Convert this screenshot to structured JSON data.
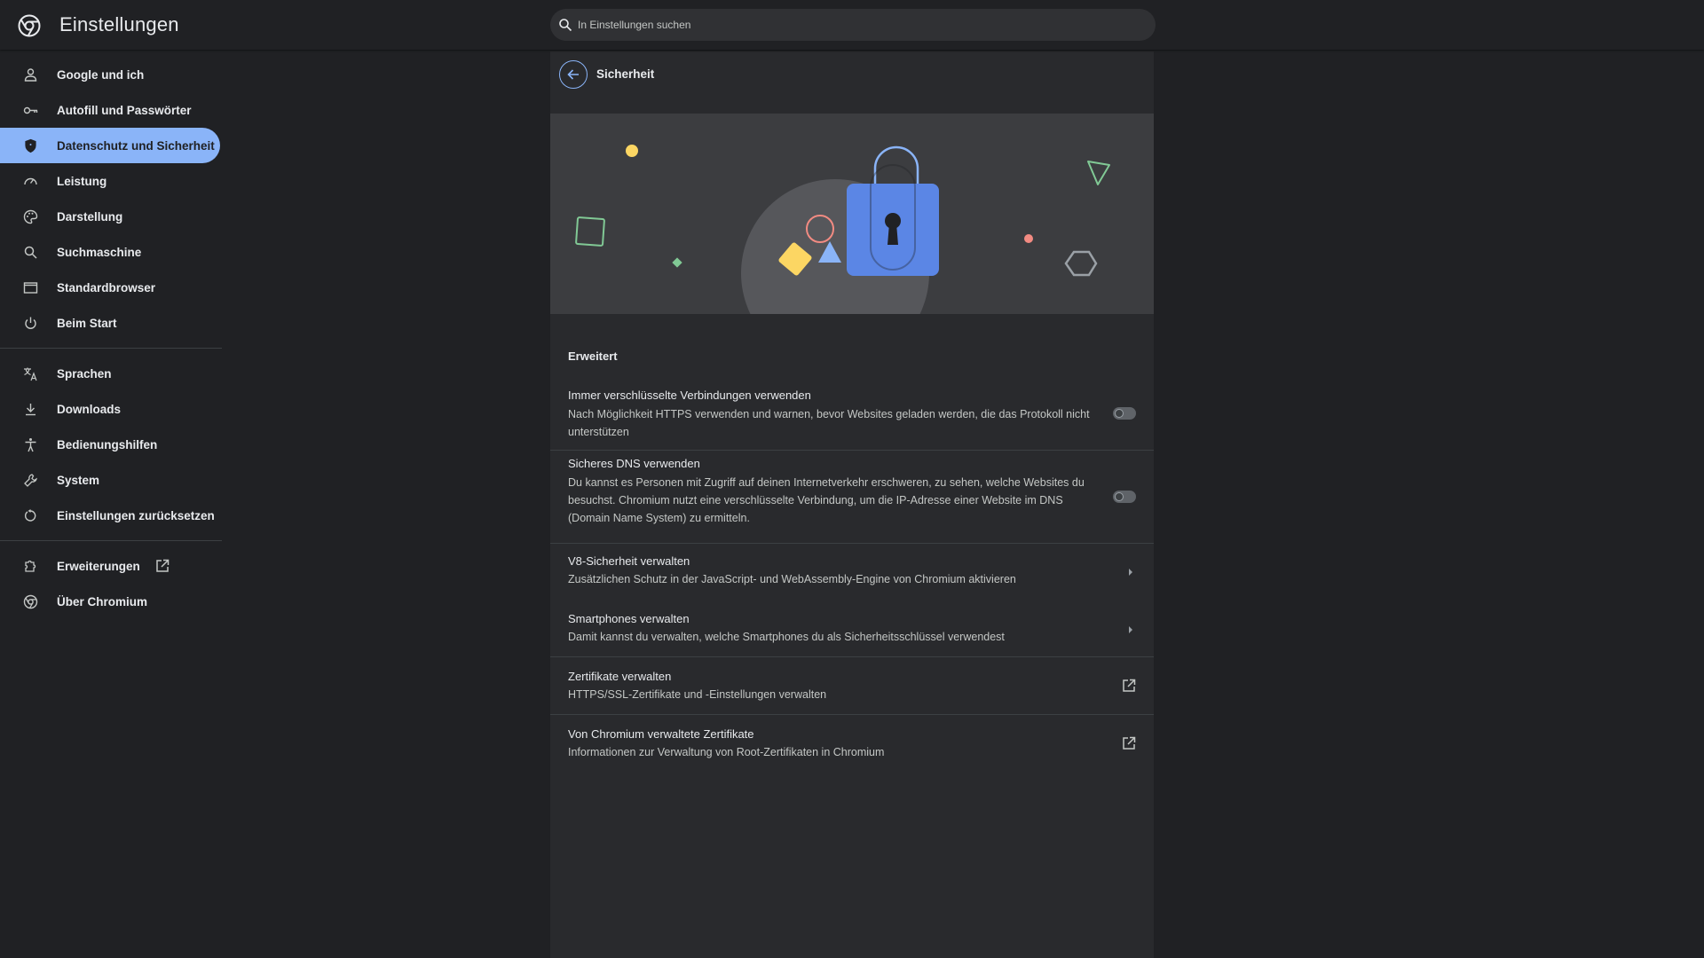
{
  "app": {
    "title": "Einstellungen",
    "search_placeholder": "In Einstellungen suchen"
  },
  "sidebar": {
    "items": [
      {
        "label": "Google und ich",
        "icon": "person-icon"
      },
      {
        "label": "Autofill und Passwörter",
        "icon": "key-icon"
      },
      {
        "label": "Datenschutz und Sicherheit",
        "icon": "shield-icon",
        "active": true
      },
      {
        "label": "Leistung",
        "icon": "speedometer-icon"
      },
      {
        "label": "Darstellung",
        "icon": "palette-icon"
      },
      {
        "label": "Suchmaschine",
        "icon": "search-icon"
      },
      {
        "label": "Standardbrowser",
        "icon": "browser-window-icon"
      },
      {
        "label": "Beim Start",
        "icon": "power-icon"
      }
    ],
    "items2": [
      {
        "label": "Sprachen",
        "icon": "translate-icon"
      },
      {
        "label": "Downloads",
        "icon": "download-icon"
      },
      {
        "label": "Bedienungshilfen",
        "icon": "accessibility-icon"
      },
      {
        "label": "System",
        "icon": "wrench-icon"
      },
      {
        "label": "Einstellungen zurücksetzen",
        "icon": "reset-icon"
      }
    ],
    "items3": [
      {
        "label": "Erweiterungen",
        "icon": "puzzle-icon"
      },
      {
        "label": "Über Chromium",
        "icon": "chromium-icon"
      }
    ]
  },
  "page": {
    "title": "Sicherheit",
    "section": "Erweitert",
    "rows": [
      {
        "title": "Immer verschlüsselte Verbindungen verwenden",
        "desc": "Nach Möglichkeit HTTPS verwenden und warnen, bevor Websites geladen werden, die das Protokoll nicht unterstützen",
        "control": "toggle",
        "on": false
      },
      {
        "title": "Sicheres DNS verwenden",
        "desc": "Du kannst es Personen mit Zugriff auf deinen Internetverkehr erschweren, zu sehen, welche Websites du besuchst. Chromium nutzt eine verschlüsselte Verbindung, um die IP-Adresse einer Website im DNS (Domain Name System) zu ermitteln.",
        "control": "toggle",
        "on": false
      },
      {
        "title": "V8-Sicherheit verwalten",
        "desc": "Zusätzlichen Schutz in der JavaScript- und WebAssembly-Engine von Chromium aktivieren",
        "control": "chevron"
      },
      {
        "title": "Smartphones verwalten",
        "desc": "Damit kannst du verwalten, welche Smartphones du als Sicherheitsschlüssel verwendest",
        "control": "chevron"
      },
      {
        "title": "Zertifikate verwalten",
        "desc": "HTTPS/SSL-Zertifikate und -Einstellungen verwalten",
        "control": "external"
      },
      {
        "title": "Von Chromium verwaltete Zertifikate",
        "desc": "Informationen zur Verwaltung von Root-Zertifikaten in Chromium",
        "control": "external"
      }
    ]
  },
  "colors": {
    "background": "#202124",
    "card": "#292a2d",
    "accent": "#8ab4f8",
    "lock": "#5b86e5"
  }
}
